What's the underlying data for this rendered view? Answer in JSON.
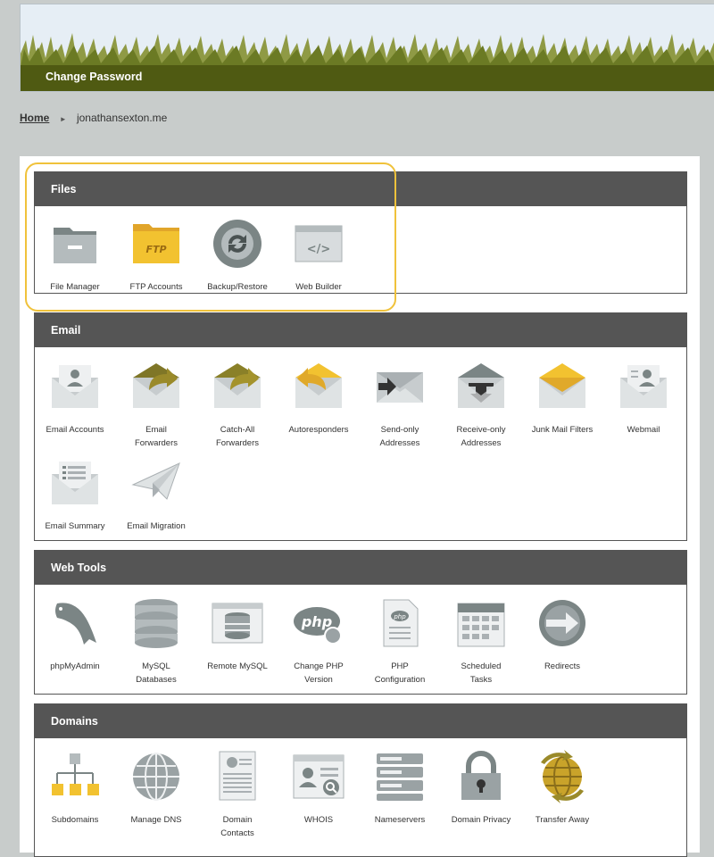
{
  "header": {
    "change_password": "Change Password"
  },
  "breadcrumb": {
    "home": "Home",
    "site": "jonathansexton.me"
  },
  "panels": [
    {
      "title": "Files",
      "items": [
        {
          "label": "File Manager",
          "icon": "folder-icon"
        },
        {
          "label": "FTP Accounts",
          "icon": "ftp-folder-icon"
        },
        {
          "label": "Backup/Restore",
          "icon": "backup-restore-icon"
        },
        {
          "label": "Web Builder",
          "icon": "web-builder-icon"
        }
      ]
    },
    {
      "title": "Email",
      "items": [
        {
          "label": "Email Accounts",
          "icon": "email-account-icon"
        },
        {
          "label": "Email\nForwarders",
          "icon": "email-forward-icon"
        },
        {
          "label": "Catch-All\nForwarders",
          "icon": "catch-all-icon"
        },
        {
          "label": "Autoresponders",
          "icon": "autoresponder-icon"
        },
        {
          "label": "Send-only\nAddresses",
          "icon": "send-only-icon"
        },
        {
          "label": "Receive-only\nAddresses",
          "icon": "receive-only-icon"
        },
        {
          "label": "Junk Mail Filters",
          "icon": "junk-mail-icon"
        },
        {
          "label": "Webmail",
          "icon": "webmail-icon"
        },
        {
          "label": "Email Summary",
          "icon": "email-summary-icon"
        },
        {
          "label": "Email Migration",
          "icon": "paper-plane-icon"
        }
      ]
    },
    {
      "title": "Web Tools",
      "items": [
        {
          "label": "phpMyAdmin",
          "icon": "dolphin-icon"
        },
        {
          "label": "MySQL\nDatabases",
          "icon": "database-icon"
        },
        {
          "label": "Remote MySQL",
          "icon": "remote-db-icon"
        },
        {
          "label": "Change PHP\nVersion",
          "icon": "php-change-icon"
        },
        {
          "label": "PHP\nConfiguration",
          "icon": "php-config-icon"
        },
        {
          "label": "Scheduled\nTasks",
          "icon": "calendar-icon"
        },
        {
          "label": "Redirects",
          "icon": "redirect-globe-icon"
        }
      ]
    },
    {
      "title": "Domains",
      "items": [
        {
          "label": "Subdomains",
          "icon": "subdomain-tree-icon"
        },
        {
          "label": "Manage DNS",
          "icon": "dns-globe-icon"
        },
        {
          "label": "Domain\nContacts",
          "icon": "contacts-doc-icon"
        },
        {
          "label": "WHOIS",
          "icon": "whois-icon"
        },
        {
          "label": "Nameservers",
          "icon": "server-icon"
        },
        {
          "label": "Domain Privacy",
          "icon": "padlock-icon"
        },
        {
          "label": "Transfer Away",
          "icon": "transfer-globe-icon"
        }
      ]
    }
  ]
}
